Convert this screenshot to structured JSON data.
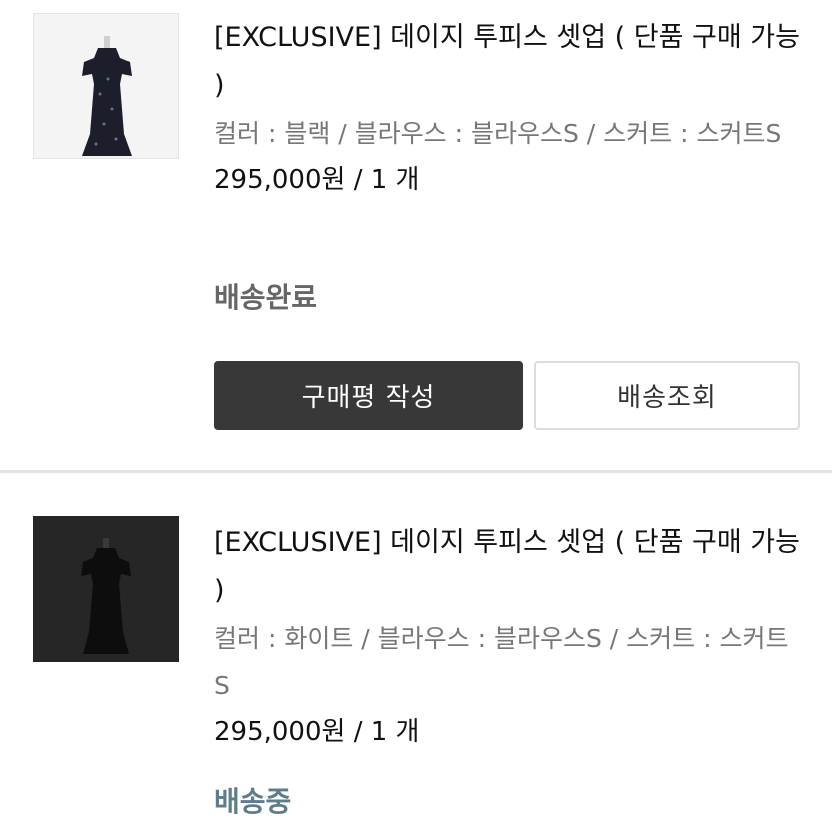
{
  "orders": [
    {
      "title": "[EXCLUSIVE] 데이지 투피스 셋업 ( 단품 구매 가능 )",
      "option": "컬러 : 블랙 / 블라우스 : 블라우스S / 스커트 : 스커트S",
      "price": "295,000원 / 1 개",
      "status": "배송완료",
      "buttons": {
        "review": "구매평 작성",
        "track": "배송조회"
      },
      "thumbnail_icon": "black-dress-photo"
    },
    {
      "title": "[EXCLUSIVE] 데이지 투피스 셋업 ( 단품 구매 가능 )",
      "option": "컬러 : 화이트 / 블라우스 : 블라우스S / 스커트 : 스커트S",
      "price": "295,000원 / 1 개",
      "status": "배송중",
      "thumbnail_icon": "dress-photo-dark-background"
    }
  ],
  "colors": {
    "status_delivered": "#666666",
    "status_shipping": "#5e7c8c",
    "primary_button": "#383838"
  }
}
